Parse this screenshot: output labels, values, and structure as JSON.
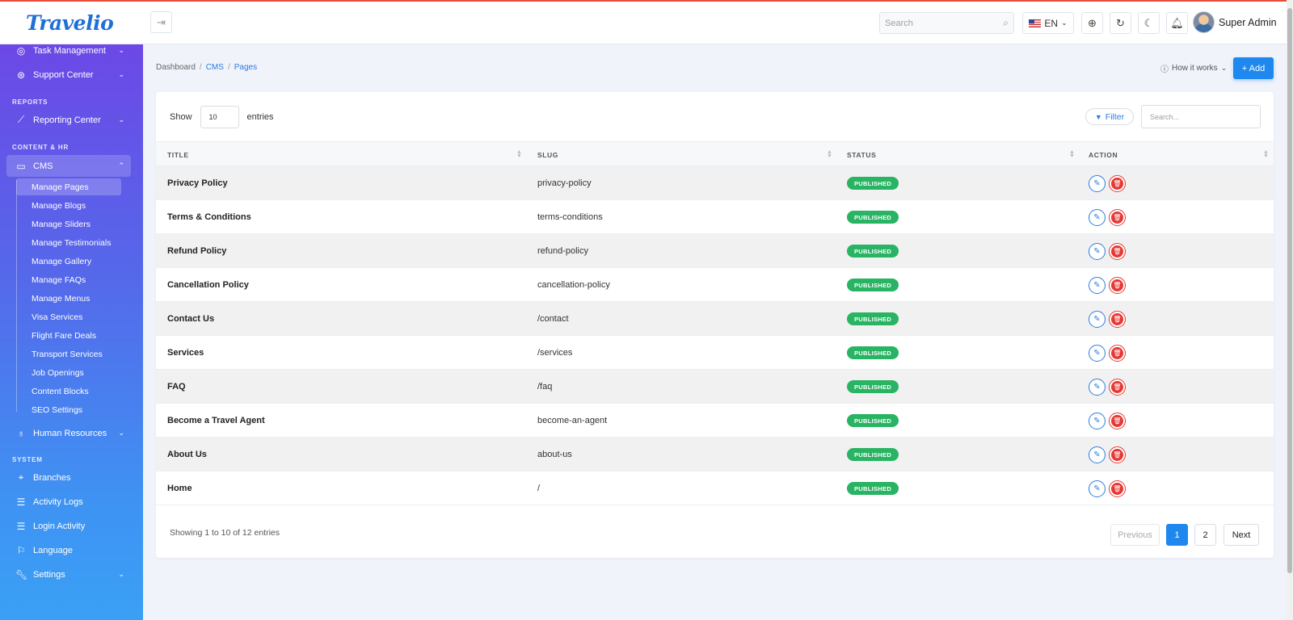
{
  "brand": {
    "name": "Travelio"
  },
  "topbar": {
    "search_placeholder": "Search",
    "language": "EN",
    "user_name": "Super Admin"
  },
  "sidebar": {
    "items_top": [
      {
        "label": "Task Management"
      },
      {
        "label": "Support Center"
      }
    ],
    "section_reports": "REPORTS",
    "reporting_center": "Reporting Center",
    "section_content": "CONTENT & HR",
    "cms": "CMS",
    "cms_sub": [
      {
        "label": "Manage Pages"
      },
      {
        "label": "Manage Blogs"
      },
      {
        "label": "Manage Sliders"
      },
      {
        "label": "Manage Testimonials"
      },
      {
        "label": "Manage Gallery"
      },
      {
        "label": "Manage FAQs"
      },
      {
        "label": "Manage Menus"
      },
      {
        "label": "Visa Services"
      },
      {
        "label": "Flight Fare Deals"
      },
      {
        "label": "Transport Services"
      },
      {
        "label": "Job Openings"
      },
      {
        "label": "Content Blocks"
      },
      {
        "label": "SEO Settings"
      }
    ],
    "human_resources": "Human Resources",
    "section_system": "SYSTEM",
    "system_items": [
      {
        "label": "Branches"
      },
      {
        "label": "Activity Logs"
      },
      {
        "label": "Login Activity"
      },
      {
        "label": "Language"
      },
      {
        "label": "Settings"
      }
    ]
  },
  "breadcrumb": {
    "home": "Dashboard",
    "cms": "CMS",
    "current": "Pages"
  },
  "header": {
    "how_it_works": "How it works",
    "add": "+ Add"
  },
  "table": {
    "show": "Show",
    "entries_value": "10",
    "entries": "entries",
    "filter": "Filter",
    "search_placeholder": "Search...",
    "columns": {
      "title": "TITLE",
      "slug": "SLUG",
      "status": "STATUS",
      "action": "ACTION"
    },
    "rows": [
      {
        "title": "Privacy Policy",
        "slug": "privacy-policy",
        "status": "PUBLISHED"
      },
      {
        "title": "Terms & Conditions",
        "slug": "terms-conditions",
        "status": "PUBLISHED"
      },
      {
        "title": "Refund Policy",
        "slug": "refund-policy",
        "status": "PUBLISHED"
      },
      {
        "title": "Cancellation Policy",
        "slug": "cancellation-policy",
        "status": "PUBLISHED"
      },
      {
        "title": "Contact Us",
        "slug": "/contact",
        "status": "PUBLISHED"
      },
      {
        "title": "Services",
        "slug": "/services",
        "status": "PUBLISHED"
      },
      {
        "title": "FAQ",
        "slug": "/faq",
        "status": "PUBLISHED"
      },
      {
        "title": "Become a Travel Agent",
        "slug": "become-an-agent",
        "status": "PUBLISHED"
      },
      {
        "title": "About Us",
        "slug": "about-us",
        "status": "PUBLISHED"
      },
      {
        "title": "Home",
        "slug": "/",
        "status": "PUBLISHED"
      }
    ],
    "showing": "Showing 1 to 10 of 12 entries",
    "pagination": {
      "previous": "Previous",
      "page1": "1",
      "page2": "2",
      "next": "Next"
    }
  },
  "colors": {
    "accent": "#1e88ef",
    "published": "#28b463",
    "delete": "#e53935"
  }
}
